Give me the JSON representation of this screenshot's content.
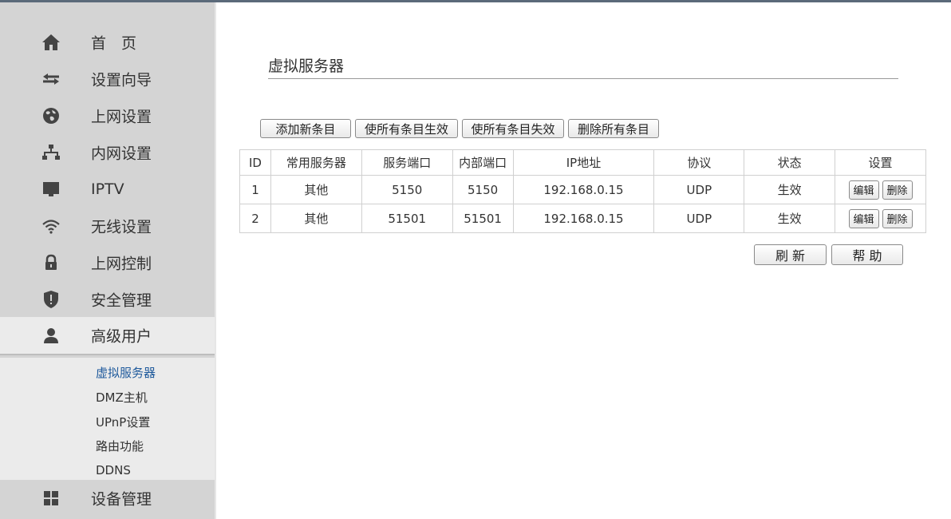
{
  "sidebar": {
    "items": [
      {
        "label": "首　页",
        "icon": "home-icon"
      },
      {
        "label": "设置向导",
        "icon": "swap-arrows-icon"
      },
      {
        "label": "上网设置",
        "icon": "globe-icon"
      },
      {
        "label": "内网设置",
        "icon": "network-tree-icon"
      },
      {
        "label": "IPTV",
        "icon": "tv-icon"
      },
      {
        "label": "无线设置",
        "icon": "wifi-icon"
      },
      {
        "label": "上网控制",
        "icon": "lock-icon"
      },
      {
        "label": "安全管理",
        "icon": "shield-icon"
      },
      {
        "label": "高级用户",
        "icon": "user-icon"
      },
      {
        "label": "设备管理",
        "icon": "grid-icon"
      }
    ],
    "submenu": [
      {
        "label": "虚拟服务器",
        "active": true
      },
      {
        "label": "DMZ主机"
      },
      {
        "label": "UPnP设置"
      },
      {
        "label": "路由功能"
      },
      {
        "label": "DDNS"
      }
    ]
  },
  "main": {
    "title": "虚拟服务器",
    "toolbar": {
      "add_label": "添加新条目",
      "enable_all_label": "使所有条目生效",
      "disable_all_label": "使所有条目失效",
      "delete_all_label": "删除所有条目"
    },
    "table": {
      "headers": [
        "ID",
        "常用服务器",
        "服务端口",
        "内部端口",
        "IP地址",
        "协议",
        "状态",
        "设置"
      ],
      "rows": [
        [
          "1",
          "其他",
          "5150",
          "5150",
          "192.168.0.15",
          "UDP",
          "生效"
        ],
        [
          "2",
          "其他",
          "51501",
          "51501",
          "192.168.0.15",
          "UDP",
          "生效"
        ]
      ],
      "edit_label": "编辑",
      "delete_label": "删除"
    },
    "refresh_label": "刷 新",
    "help_label": "帮 助"
  },
  "colors": {
    "sidebar_bg": "#d4d4d4",
    "submenu_bg": "#ebebeb",
    "active_link": "#1f5a9c"
  }
}
